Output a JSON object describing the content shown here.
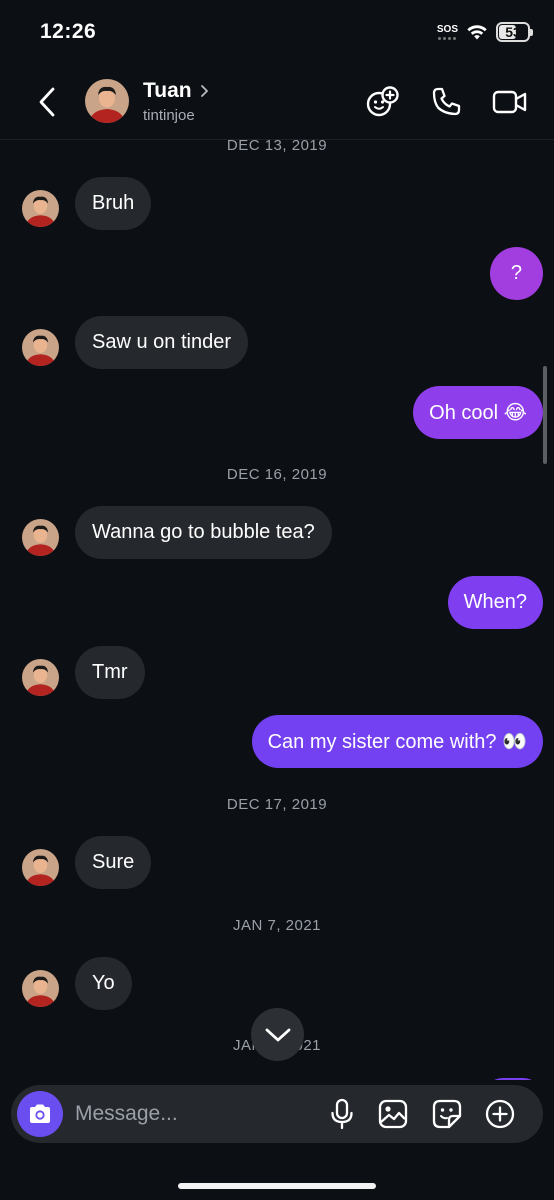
{
  "status_bar": {
    "time": "12:26",
    "sos": "SOS",
    "battery": "53"
  },
  "header": {
    "name": "Tuan",
    "username": "tintinjoe",
    "icons": [
      "back-chevron-icon",
      "chevron-right-icon",
      "games-icon",
      "phone-icon",
      "video-camera-icon"
    ]
  },
  "chat": {
    "dates": [
      "DEC 13, 2019",
      "DEC 16, 2019",
      "DEC 17, 2019",
      "JAN 7, 2021",
      "JAN 7, 2021"
    ],
    "messages": [
      {
        "sender": "them",
        "text": "Bruh"
      },
      {
        "sender": "me",
        "text": "?"
      },
      {
        "sender": "them",
        "text": "Saw u on tinder"
      },
      {
        "sender": "me",
        "text": "Oh cool 😂"
      },
      {
        "sender": "them",
        "text": "Wanna go to bubble tea?"
      },
      {
        "sender": "me",
        "text": "When?"
      },
      {
        "sender": "them",
        "text": "Tmr"
      },
      {
        "sender": "me",
        "text": "Can my sister come with? 👀"
      },
      {
        "sender": "them",
        "text": "Sure"
      },
      {
        "sender": "them",
        "text": "Yo"
      }
    ]
  },
  "composer": {
    "placeholder": "Message...",
    "icons": [
      "camera-icon",
      "microphone-icon",
      "gallery-icon",
      "sticker-icon",
      "plus-circle-icon"
    ]
  },
  "colors": {
    "background": "#0c0f14",
    "incoming_bubble": "#25282d",
    "outgoing_gradient": [
      "#a23ee0",
      "#7a3ff0",
      "#6a4ef0"
    ],
    "camera_button": "#6a4ef0"
  }
}
